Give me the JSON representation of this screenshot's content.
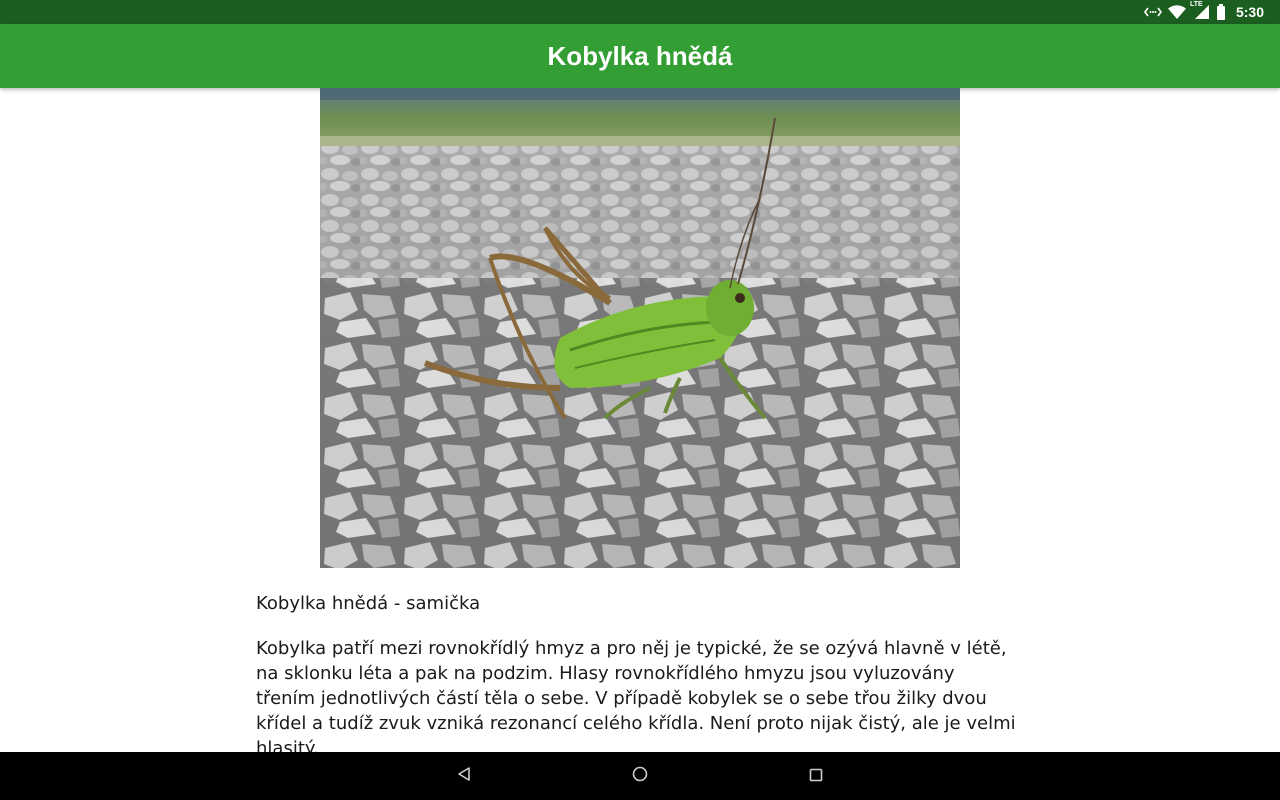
{
  "status_bar": {
    "time": "5:30",
    "icons": [
      "data-transfer-icon",
      "wifi-icon",
      "lte-signal-icon",
      "battery-icon"
    ],
    "network_label": "LTE"
  },
  "app_bar": {
    "title": "Kobylka hnědá",
    "color": "#339e33"
  },
  "article": {
    "image_alt": "photo of a green bush-cricket on gravel",
    "caption": "Kobylka hnědá - samička",
    "description": "Kobylka patří mezi rovnokřídlý hmyz a pro něj je typické, že se ozývá hlavně v létě, na sklonku léta a pak na podzim. Hlasy rovnokřídlého hmyzu jsou vyluzovány třením jednotlivých částí těla o sebe. V případě kobylek se o sebe třou žilky dvou křídel a tudíž zvuk vzniká rezonancí celého křídla. Není proto nijak čistý, ale je velmi hlasitý."
  },
  "nav_bar": {
    "buttons": [
      "back-icon",
      "home-icon",
      "recents-icon"
    ]
  }
}
